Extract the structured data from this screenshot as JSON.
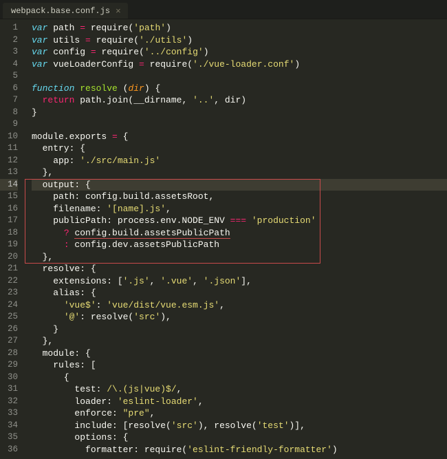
{
  "tab": {
    "filename": "webpack.base.conf.js",
    "close_glyph": "×"
  },
  "gutter": {
    "lines": [
      "1",
      "2",
      "3",
      "4",
      "5",
      "6",
      "7",
      "8",
      "9",
      "10",
      "11",
      "12",
      "13",
      "14",
      "15",
      "16",
      "17",
      "18",
      "19",
      "20",
      "21",
      "22",
      "23",
      "24",
      "25",
      "26",
      "27",
      "28",
      "29",
      "30",
      "31",
      "32",
      "33",
      "34",
      "35",
      "36"
    ]
  },
  "code": {
    "l1": {
      "var": "var",
      "id": " path ",
      "eq": "=",
      "req": " require",
      "p1": "(",
      "s": "'path'",
      "p2": ")"
    },
    "l2": {
      "var": "var",
      "id": " utils ",
      "eq": "=",
      "req": " require",
      "p1": "(",
      "s": "'./utils'",
      "p2": ")"
    },
    "l3": {
      "var": "var",
      "id": " config ",
      "eq": "=",
      "req": " require",
      "p1": "(",
      "s": "'../config'",
      "p2": ")"
    },
    "l4": {
      "var": "var",
      "id": " vueLoaderConfig ",
      "eq": "=",
      "req": " require",
      "p1": "(",
      "s": "'./vue-loader.conf'",
      "p2": ")"
    },
    "l6": {
      "fn": "function",
      "name": " resolve ",
      "p1": "(",
      "param": "dir",
      "p2": ") {"
    },
    "l7": {
      "ret": "return",
      "call": " path.join(__dirname, ",
      "s1": "'..'",
      "c": ", dir)"
    },
    "l8": {
      "b": "}"
    },
    "l10": {
      "a": "module.exports ",
      "eq": "=",
      "b": " {"
    },
    "l11": {
      "a": "  entry: {"
    },
    "l12": {
      "a": "    app: ",
      "s": "'./src/main.js'"
    },
    "l13": {
      "a": "  },"
    },
    "l14": {
      "a": "  output: {"
    },
    "l15": {
      "a": "    path: config.build.assetsRoot,"
    },
    "l16": {
      "a": "    filename: ",
      "s": "'[name].js'",
      "c": ","
    },
    "l17": {
      "a": "    publicPath: process.env.NODE_ENV ",
      "op": "===",
      "sp": " ",
      "s": "'production'"
    },
    "l18": {
      "a": "      ",
      "q": "?",
      "sp": " ",
      "u": "config.build.assetsPublicPath"
    },
    "l19": {
      "a": "      ",
      "q": ":",
      "b": " config.dev.assetsPublicPath"
    },
    "l20": {
      "a": "  },"
    },
    "l21": {
      "a": "  resolve: {"
    },
    "l22": {
      "a": "    extensions: [",
      "s1": "'.js'",
      "c1": ", ",
      "s2": "'.vue'",
      "c2": ", ",
      "s3": "'.json'",
      "b": "],"
    },
    "l23": {
      "a": "    alias: {"
    },
    "l24": {
      "a": "      ",
      "s1": "'vue$'",
      "c": ": ",
      "s2": "'vue/dist/vue.esm.js'",
      "d": ","
    },
    "l25": {
      "a": "      ",
      "s1": "'@'",
      "c": ": resolve(",
      "s2": "'src'",
      "d": "),"
    },
    "l26": {
      "a": "    }"
    },
    "l27": {
      "a": "  },"
    },
    "l28": {
      "a": "  module: {"
    },
    "l29": {
      "a": "    rules: ["
    },
    "l30": {
      "a": "      {"
    },
    "l31": {
      "a": "        test: ",
      "r": "/\\.(js|vue)$/",
      "c": ","
    },
    "l32": {
      "a": "        loader: ",
      "s": "'eslint-loader'",
      "c": ","
    },
    "l33": {
      "a": "        enforce: ",
      "s": "\"pre\"",
      "c": ","
    },
    "l34": {
      "a": "        include: [resolve(",
      "s1": "'src'",
      "b": "), resolve(",
      "s2": "'test'",
      "c": ")],"
    },
    "l35": {
      "a": "        options: {"
    },
    "l36": {
      "a": "          formatter: require(",
      "s": "'eslint-friendly-formatter'",
      "c": ")"
    }
  },
  "highlight": {
    "top_line": 14,
    "bottom_line": 20
  }
}
